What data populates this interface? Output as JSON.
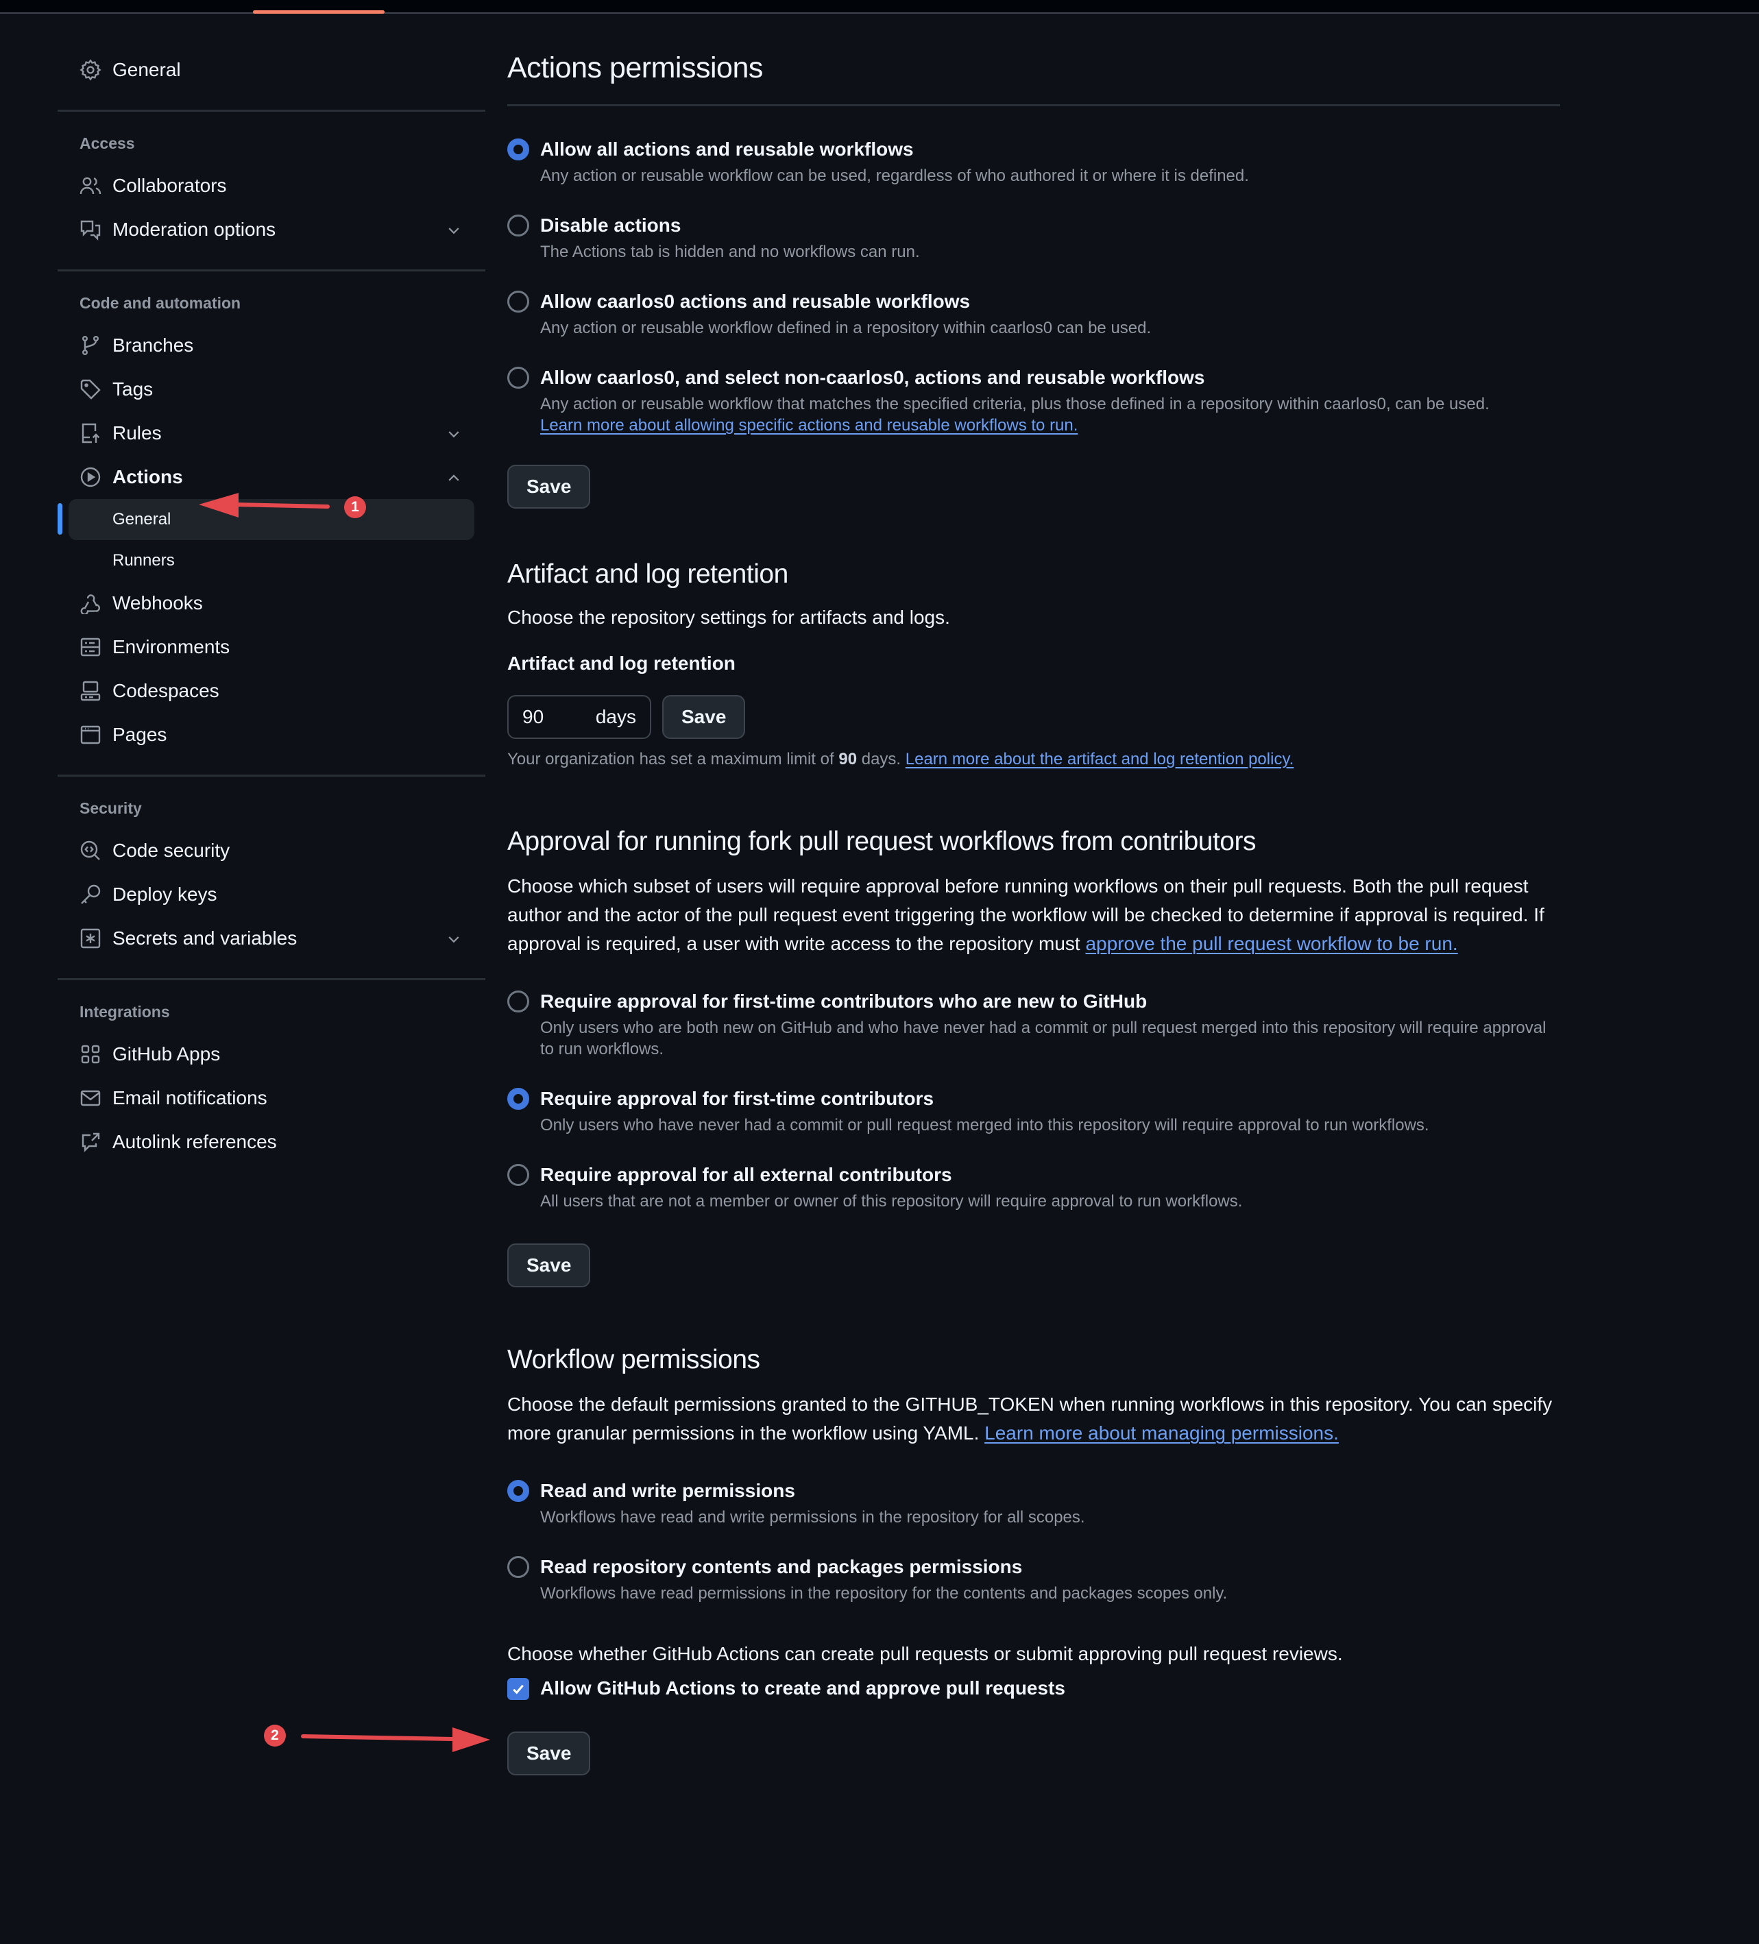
{
  "colors": {
    "background": "#0d1117",
    "accent": "#4178e0",
    "link": "#6d9ff5",
    "tab_underline": "#f78166",
    "annotation": "#e5484d"
  },
  "sidebar": {
    "general": {
      "label": "General",
      "icon": "gear-icon"
    },
    "sections": [
      {
        "heading": "Access",
        "items": [
          {
            "label": "Collaborators",
            "icon": "people-icon"
          },
          {
            "label": "Moderation options",
            "icon": "comment-discussion-icon",
            "chevron": "down"
          }
        ]
      },
      {
        "heading": "Code and automation",
        "items": [
          {
            "label": "Branches",
            "icon": "git-branch-icon"
          },
          {
            "label": "Tags",
            "icon": "tag-icon"
          },
          {
            "label": "Rules",
            "icon": "repo-push-icon",
            "chevron": "down"
          },
          {
            "label": "Actions",
            "icon": "play-icon",
            "chevron": "up",
            "expanded": true,
            "children": [
              {
                "label": "General",
                "active": true
              },
              {
                "label": "Runners"
              }
            ]
          },
          {
            "label": "Webhooks",
            "icon": "webhook-icon"
          },
          {
            "label": "Environments",
            "icon": "server-icon"
          },
          {
            "label": "Codespaces",
            "icon": "codespaces-icon"
          },
          {
            "label": "Pages",
            "icon": "browser-icon"
          }
        ]
      },
      {
        "heading": "Security",
        "items": [
          {
            "label": "Code security",
            "icon": "codescan-icon"
          },
          {
            "label": "Deploy keys",
            "icon": "key-icon"
          },
          {
            "label": "Secrets and variables",
            "icon": "key-asterisk-icon",
            "chevron": "down"
          }
        ]
      },
      {
        "heading": "Integrations",
        "items": [
          {
            "label": "GitHub Apps",
            "icon": "apps-icon"
          },
          {
            "label": "Email notifications",
            "icon": "mail-icon"
          },
          {
            "label": "Autolink references",
            "icon": "cross-reference-icon"
          }
        ]
      }
    ]
  },
  "actions_permissions": {
    "title": "Actions permissions",
    "options": [
      {
        "label": "Allow all actions and reusable workflows",
        "desc": "Any action or reusable workflow can be used, regardless of who authored it or where it is defined.",
        "checked": true
      },
      {
        "label": "Disable actions",
        "desc": "The Actions tab is hidden and no workflows can run.",
        "checked": false
      },
      {
        "label": "Allow caarlos0 actions and reusable workflows",
        "desc": "Any action or reusable workflow defined in a repository within caarlos0 can be used.",
        "checked": false
      },
      {
        "label": "Allow caarlos0, and select non-caarlos0, actions and reusable workflows",
        "desc": "Any action or reusable workflow that matches the specified criteria, plus those defined in a repository within caarlos0, can be used.",
        "link": "Learn more about allowing specific actions and reusable workflows to run.",
        "checked": false
      }
    ],
    "save_label": "Save"
  },
  "retention": {
    "title": "Artifact and log retention",
    "description": "Choose the repository settings for artifacts and logs.",
    "field_label": "Artifact and log retention",
    "value": "90",
    "unit": "days",
    "save_label": "Save",
    "note_prefix": "Your organization has set a maximum limit of",
    "note_value": "90",
    "note_suffix": "days.",
    "note_link": "Learn more about the artifact and log retention policy."
  },
  "fork_approval": {
    "title": "Approval for running fork pull request workflows from contributors",
    "description": "Choose which subset of users will require approval before running workflows on their pull requests. Both the pull request author and the actor of the pull request event triggering the workflow will be checked to determine if approval is required. If approval is required, a user with write access to the repository must",
    "description_link": "approve the pull request workflow to be run.",
    "options": [
      {
        "label": "Require approval for first-time contributors who are new to GitHub",
        "desc": "Only users who are both new on GitHub and who have never had a commit or pull request merged into this repository will require approval to run workflows.",
        "checked": false
      },
      {
        "label": "Require approval for first-time contributors",
        "desc": "Only users who have never had a commit or pull request merged into this repository will require approval to run workflows.",
        "checked": true
      },
      {
        "label": "Require approval for all external contributors",
        "desc": "All users that are not a member or owner of this repository will require approval to run workflows.",
        "checked": false
      }
    ],
    "save_label": "Save"
  },
  "workflow_permissions": {
    "title": "Workflow permissions",
    "description": "Choose the default permissions granted to the GITHUB_TOKEN when running workflows in this repository. You can specify more granular permissions in the workflow using YAML.",
    "description_link": "Learn more about managing permissions.",
    "options": [
      {
        "label": "Read and write permissions",
        "desc": "Workflows have read and write permissions in the repository for all scopes.",
        "checked": true
      },
      {
        "label": "Read repository contents and packages permissions",
        "desc": "Workflows have read permissions in the repository for the contents and packages scopes only.",
        "checked": false
      }
    ],
    "pr_description": "Choose whether GitHub Actions can create pull requests or submit approving pull request reviews.",
    "pr_checkbox_label": "Allow GitHub Actions to create and approve pull requests",
    "pr_checkbox_checked": true,
    "save_label": "Save"
  },
  "annotations": [
    {
      "number": "1",
      "target": "Actions > General"
    },
    {
      "number": "2",
      "target": "Allow GitHub Actions to create and approve pull requests"
    }
  ]
}
